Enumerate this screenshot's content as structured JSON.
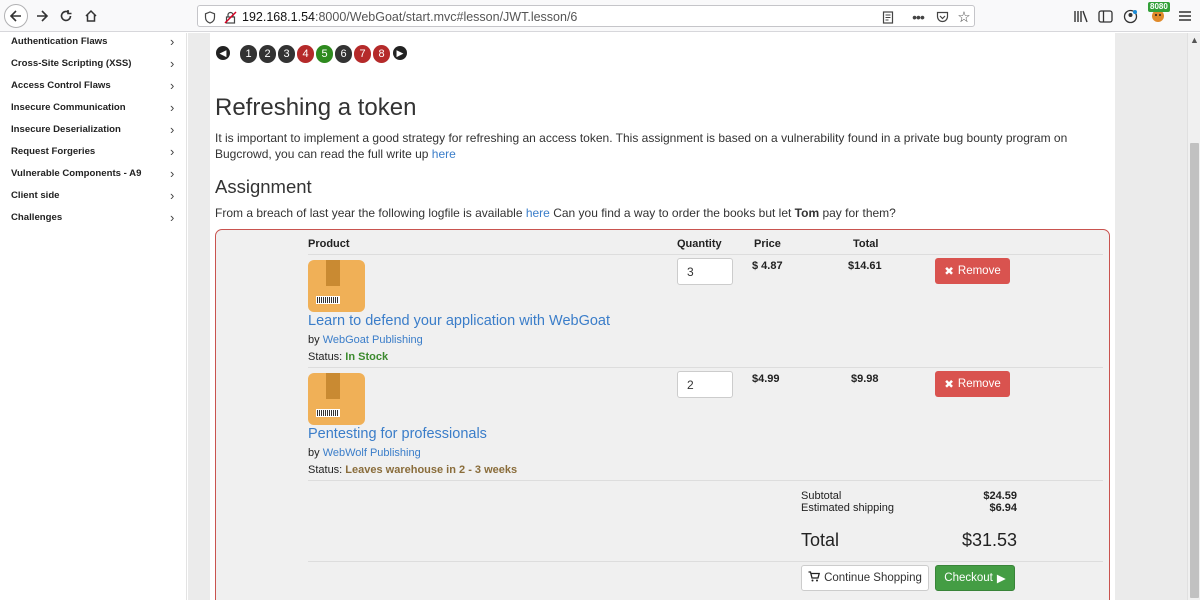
{
  "browser": {
    "url_host": "192.168.1.54",
    "url_rest": ":8000/WebGoat/start.mvc#lesson/JWT.lesson/6",
    "extension_badge": "8080"
  },
  "sidebar": {
    "items": [
      {
        "label": "Authentication Flaws"
      },
      {
        "label": "Cross-Site Scripting (XSS)"
      },
      {
        "label": "Access Control Flaws"
      },
      {
        "label": "Insecure Communication"
      },
      {
        "label": "Insecure Deserialization"
      },
      {
        "label": "Request Forgeries"
      },
      {
        "label": "Vulnerable Components - A9"
      },
      {
        "label": "Client side"
      },
      {
        "label": "Challenges"
      }
    ]
  },
  "pager": {
    "pages": [
      {
        "num": "1",
        "color": "#333333"
      },
      {
        "num": "2",
        "color": "#333333"
      },
      {
        "num": "3",
        "color": "#333333"
      },
      {
        "num": "4",
        "color": "#b52a2a"
      },
      {
        "num": "5",
        "color": "#2e8a1e"
      },
      {
        "num": "6",
        "color": "#333333"
      },
      {
        "num": "7",
        "color": "#b52a2a"
      },
      {
        "num": "8",
        "color": "#b52a2a"
      }
    ]
  },
  "lesson": {
    "title": "Refreshing a token",
    "intro": "It is important to implement a good strategy for refreshing an access token. This assignment is based on a vulnerability found in a private bug bounty program on Bugcrowd, you can read the full write up ",
    "intro_link": "here",
    "assignment_heading": "Assignment",
    "breach_prefix": "From a breach of last year the following logfile is available ",
    "breach_link": "here",
    "breach_middle": " Can you find a way to order the books but let ",
    "breach_bold": "Tom",
    "breach_suffix": " pay for them?"
  },
  "cart": {
    "headers": {
      "product": "Product",
      "quantity": "Quantity",
      "price": "Price",
      "total": "Total"
    },
    "items": [
      {
        "title": "Learn to defend your application with WebGoat",
        "by": "by ",
        "publisher": "WebGoat Publishing",
        "status_label": "Status: ",
        "status": "In Stock",
        "quantity": "3",
        "price": "$ 4.87",
        "total": "$14.61",
        "remove_label": "Remove"
      },
      {
        "title": "Pentesting for professionals",
        "by": "by ",
        "publisher": "WebWolf Publishing",
        "status_label": "Status: ",
        "status": "Leaves warehouse in 2 - 3 weeks",
        "quantity": "2",
        "price": "$4.99",
        "total": "$9.98",
        "remove_label": "Remove"
      }
    ],
    "subtotal_label": "Subtotal",
    "subtotal": "$24.59",
    "shipping_label": "Estimated shipping",
    "shipping": "$6.94",
    "total_label": "Total",
    "total": "$31.53",
    "continue_label": "Continue Shopping",
    "checkout_label": "Checkout"
  }
}
